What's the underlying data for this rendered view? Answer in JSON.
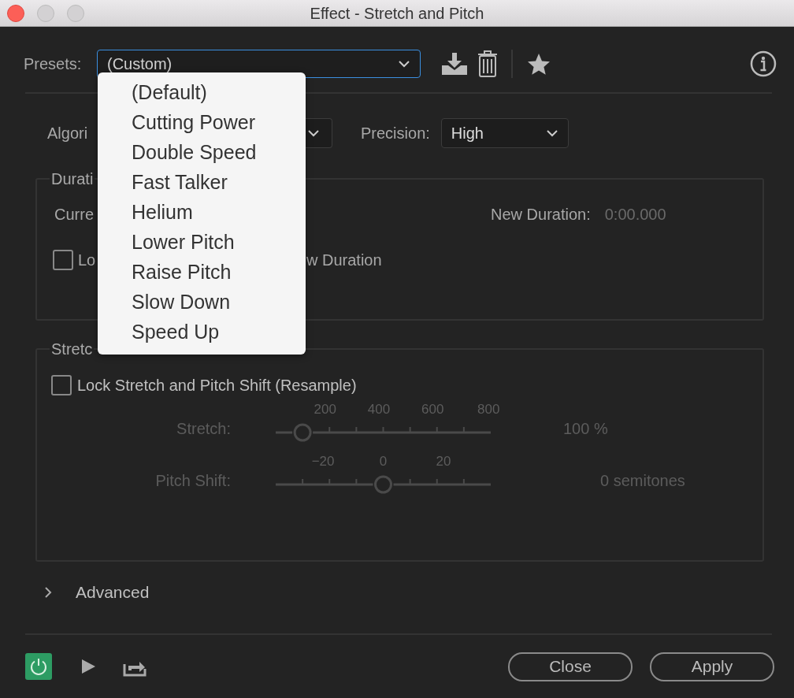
{
  "window": {
    "title": "Effect - Stretch and Pitch"
  },
  "presets": {
    "label": "Presets:",
    "value": "(Custom)",
    "focused": true,
    "menu": [
      "(Default)",
      "Cutting Power",
      "Double Speed",
      "Fast Talker",
      "Helium",
      "Lower Pitch",
      "Raise Pitch",
      "Slow Down",
      "Speed Up"
    ]
  },
  "algorithm": {
    "label": "Algori"
  },
  "precision": {
    "label": "Precision:",
    "value": "High"
  },
  "duration": {
    "legend": "Durati",
    "current_label": "Curre",
    "new_label": "New Duration:",
    "new_value": "0:00.000",
    "lock": {
      "label_start": "Lo",
      "label_end": "w Duration",
      "checked": false
    }
  },
  "stretch_pitch": {
    "legend": "Stretc",
    "lock": {
      "label": "Lock Stretch and Pitch Shift (Resample)",
      "checked": false
    },
    "sliders": [
      {
        "label": "Stretch:",
        "ticks": [
          "200",
          "400",
          "600",
          "800"
        ],
        "level": 0.125,
        "reading": "100 %",
        "disabled": true
      },
      {
        "label": "Pitch Shift:",
        "ticks": [
          "−20",
          "0",
          "20"
        ],
        "level": 0.5,
        "reading": "0 semitones",
        "disabled": true
      }
    ]
  },
  "advanced": {
    "label": "Advanced",
    "expanded": false
  },
  "footer": {
    "power_on": true,
    "buttons": [
      "Close",
      "Apply"
    ]
  }
}
